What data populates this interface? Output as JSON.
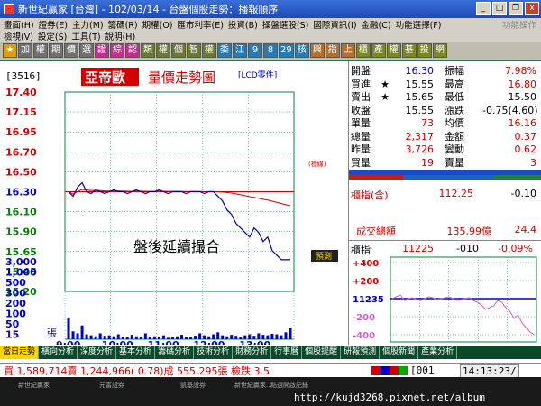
{
  "window": {
    "title": "新世紀贏家 [台灣] - 102/03/14 - 台盤個股走勢：播報順序",
    "btn_min": "_",
    "btn_max": "□",
    "btn_restore": "❐",
    "btn_close": "x"
  },
  "menu_row1": [
    "畫面(H)",
    "證券(E)",
    "主力(M)",
    "籌碼(R)",
    "期權(O)",
    "匯市利率(E)",
    "投資(B)",
    "操盤選股(S)",
    "國際資訊(I)",
    "金融(C)",
    "功能選擇(F)"
  ],
  "menu_row1_dim": "功能操作",
  "menu_row2": [
    "檢視(V)",
    "設定(S)",
    "工具(T)",
    "說明(H)"
  ],
  "toolbar": [
    {
      "t": "★",
      "c": "#d8a000"
    },
    {
      "t": "加",
      "c": "#707070"
    },
    {
      "t": "權",
      "c": "#707070"
    },
    {
      "t": "期",
      "c": "#707070"
    },
    {
      "t": "價",
      "c": "#707070"
    },
    {
      "t": "選",
      "c": "#707070"
    },
    {
      "t": "證",
      "c": "#c03090"
    },
    {
      "t": "綜",
      "c": "#c03090"
    },
    {
      "t": "認",
      "c": "#c03090"
    },
    {
      "t": "類",
      "c": "#6a7a30"
    },
    {
      "t": "權",
      "c": "#6a7a30"
    },
    {
      "t": "個",
      "c": "#6a7a30"
    },
    {
      "t": "智",
      "c": "#6a7a30"
    },
    {
      "t": "權",
      "c": "#6a7a30"
    },
    {
      "t": "委",
      "c": "#2a7ab0"
    },
    {
      "t": "江",
      "c": "#2a7ab0"
    },
    {
      "t": "9",
      "c": "#2a7ab0"
    },
    {
      "t": "8",
      "c": "#2a7ab0"
    },
    {
      "t": "29",
      "c": "#2a7ab0"
    },
    {
      "t": "核",
      "c": "#2a7ab0"
    },
    {
      "t": "興",
      "c": "#b07030"
    },
    {
      "t": "指",
      "c": "#b07030"
    },
    {
      "t": "上",
      "c": "#b07030"
    },
    {
      "t": "櫃",
      "c": "#7a8a20"
    },
    {
      "t": "產",
      "c": "#7a8a20"
    },
    {
      "t": "權",
      "c": "#7a8a20"
    },
    {
      "t": "基",
      "c": "#7a8a20"
    },
    {
      "t": "投",
      "c": "#7a8a20"
    },
    {
      "t": "網",
      "c": "#7a8a20"
    }
  ],
  "stock": {
    "code": "[3516]",
    "name": "亞帝歐",
    "chart_title": "量價走勢圖",
    "tag": "[LCD零件]",
    "ref_label": "(標線)",
    "note": "盤後延續撮合",
    "predict_button": "預測",
    "vol_unit": "張"
  },
  "quote": [
    {
      "l1": "開盤",
      "s": "",
      "v1": "16.30",
      "c1": "#0000c8",
      "l2": "振幅",
      "v2": "7.98%",
      "c2": "#d00000"
    },
    {
      "l1": "買進",
      "s": "★",
      "v1": "15.55",
      "c1": "#000000",
      "l2": "最高",
      "v2": "16.80",
      "c2": "#d00000"
    },
    {
      "l1": "賣出",
      "s": "★",
      "v1": "15.65",
      "c1": "#000000",
      "l2": "最低",
      "v2": "15.50",
      "c2": "#000000"
    },
    {
      "l1": "收盤",
      "s": "",
      "v1": "15.55",
      "c1": "#000000",
      "l2": "漲跌",
      "v2": "-0.75(4.60)",
      "c2": "#000000"
    },
    {
      "l1": "單量",
      "s": "",
      "v1": "73",
      "c1": "#d00000",
      "l2": "均價",
      "v2": "16.16",
      "c2": "#d00000"
    },
    {
      "l1": "總量",
      "s": "",
      "v1": "2,317",
      "c1": "#d00000",
      "l2": "金額",
      "v2": "0.37",
      "c2": "#d00000"
    },
    {
      "l1": "昨量",
      "s": "",
      "v1": "3,726",
      "c1": "#d00000",
      "l2": "變動",
      "v2": "0.62",
      "c2": "#d00000"
    },
    {
      "l1": "買量",
      "s": "",
      "v1": "19",
      "c1": "#d00000",
      "l2": "賣量",
      "v2": "3",
      "c2": "#d00000"
    }
  ],
  "otc": {
    "label": "櫃指(含)",
    "value": "112.25",
    "change": "-0.10",
    "turnover_label": "成交總額",
    "turnover_value": "135.99億",
    "turnover_change": "24.4"
  },
  "mini": {
    "label": "櫃指",
    "value": "11225",
    "change": "-010",
    "pct": "-0.09%",
    "yticks": [
      "+400",
      "+200",
      "11235",
      "-200",
      "-400"
    ]
  },
  "tabs": [
    "當日走勢",
    "橫向分析",
    "深度分析",
    "基本分析",
    "籌碼分析",
    "技術分析",
    "財務分析",
    "行事曆",
    "個股提醒",
    "研報預測",
    "個股新聞",
    "產業分析"
  ],
  "status": {
    "text": "買 1,589,714賣 1,244,966( 0.78)成 555,295張  檢跌 3.5",
    "code": "[001",
    "clock": "14:13:23/"
  },
  "taskbar": [
    "新世紀贏家",
    "元富證券",
    "凱基證券",
    "新世紀贏家...",
    "點選開啟記錄"
  ],
  "watermark": "http://kujd3268.pixnet.net/album",
  "colors": {
    "price_line": "#0000a0",
    "avg_line": "#d00000",
    "volume_bar": "#0000cc",
    "grid": "#008a3a",
    "mini_line": "#d060d0"
  },
  "chart_data": {
    "type": "line",
    "price_ticks": [
      "17.40",
      "17.15",
      "16.95",
      "16.70",
      "16.50",
      "16.30",
      "16.10",
      "15.90",
      "15.65",
      "15.45",
      "15.20"
    ],
    "ylim": [
      15.2,
      17.4
    ],
    "ref_price": 16.3,
    "volume_ticks": [
      "3,000",
      "1,000",
      "500",
      "300",
      "200",
      "100",
      "50",
      "15"
    ],
    "time_ticks": [
      "9:00",
      "10:00",
      "11:00",
      "12:00",
      "13:00"
    ],
    "series": [
      {
        "values": [
          16.3,
          16.25,
          16.35,
          16.4,
          16.3,
          16.28,
          16.32,
          16.3,
          16.28,
          16.3,
          16.32,
          16.3,
          16.3,
          16.28,
          16.3,
          16.32,
          16.3,
          16.28,
          16.3,
          16.3,
          16.32,
          16.3,
          16.28,
          16.3,
          16.3,
          16.3,
          16.28,
          16.3,
          16.3,
          16.3,
          16.28,
          16.3,
          16.3,
          16.25,
          16.2,
          16.1,
          16.05,
          15.95,
          15.9,
          15.85,
          15.8,
          15.9,
          15.85,
          15.75,
          15.8,
          15.65,
          15.6,
          15.55,
          15.55,
          15.55
        ]
      }
    ],
    "volume_values": [
      220,
      80,
      60,
      140,
      50,
      40,
      30,
      60,
      35,
      40,
      30,
      50,
      25,
      20,
      45,
      30,
      20,
      60,
      25,
      30,
      20,
      40,
      15,
      25,
      30,
      45,
      20,
      25,
      35,
      60,
      40,
      30,
      50,
      70,
      40,
      30,
      45,
      35,
      25,
      40,
      50,
      35,
      60,
      45,
      40,
      55,
      50,
      40,
      70,
      120
    ]
  }
}
